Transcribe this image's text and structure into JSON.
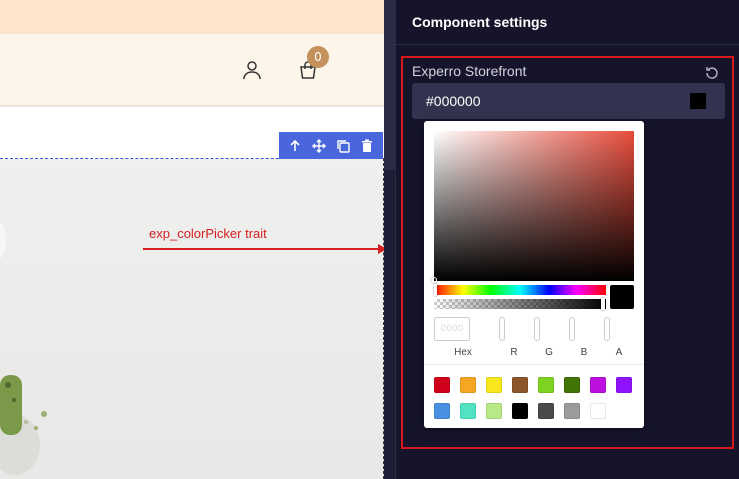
{
  "header": {
    "cart_count": "0",
    "account_icon": "user-icon",
    "cart_icon": "shopping-bag-icon"
  },
  "toolbar": {
    "icons": [
      "arrow-up-icon",
      "move-icon",
      "copy-icon",
      "delete-icon"
    ]
  },
  "annotation": {
    "label": "exp_colorPicker trait",
    "color": "#d31f1f"
  },
  "panel": {
    "title": "Component settings",
    "trait_label": "Experro Storefront",
    "color_value": "#000000",
    "reset_icon": "reset-icon"
  },
  "picker": {
    "hex_placeholder": "0000",
    "labels": {
      "hex": "Hex",
      "r": "R",
      "g": "G",
      "b": "B",
      "a": "A"
    },
    "presets": [
      "#d0021b",
      "#f5a623",
      "#f8e71c",
      "#8b572a",
      "#7ed321",
      "#417505",
      "#bd10e0",
      "#9013fe",
      "#4a90e2",
      "#50e3c2",
      "#b8e986",
      "#000000",
      "#4a4a4a",
      "#9b9b9b",
      "#ffffff"
    ]
  },
  "colors": {
    "panel_bg": "#15142b",
    "input_bg": "#34334f",
    "highlight_border": "#d9181d",
    "toolbar_bg": "#4a66dc"
  }
}
